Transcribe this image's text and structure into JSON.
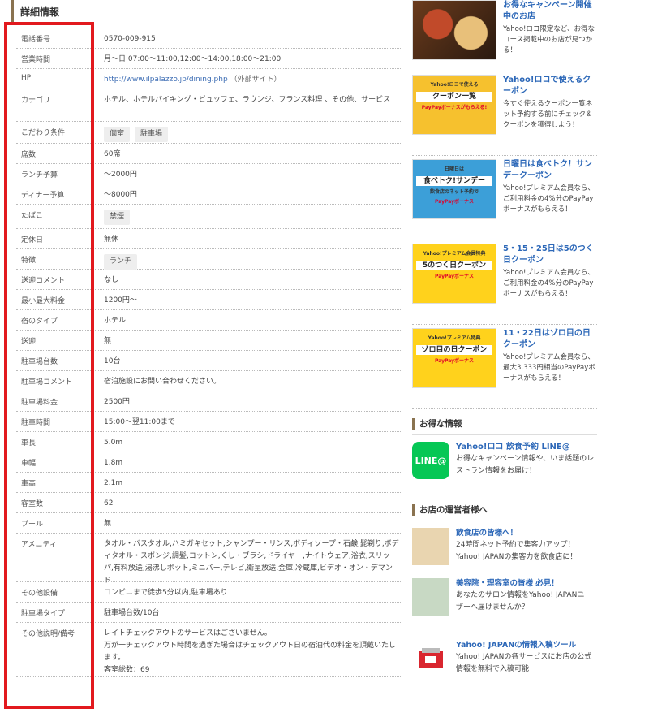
{
  "section_title": "詳細情報",
  "rows": [
    {
      "k": "電話番号",
      "v": "0570-009-915"
    },
    {
      "k": "営業時間",
      "v": "月〜日 07:00〜11:00,12:00〜14:00,18:00〜21:00"
    },
    {
      "k": "HP",
      "link": "http://www.ilpalazzo.jp/dining.php",
      "ext": "（外部サイト）"
    },
    {
      "k": "カテゴリ",
      "v": "ホテル、ホテルバイキング・ビュッフェ、ラウンジ、フランス料理 、その他、サービス"
    },
    {
      "k": "こだわり条件",
      "tags": [
        "個室",
        "駐車場"
      ]
    },
    {
      "k": "席数",
      "v": "60席"
    },
    {
      "k": "ランチ予算",
      "v": "〜2000円"
    },
    {
      "k": "ディナー予算",
      "v": "〜8000円"
    },
    {
      "k": "たばこ",
      "tags": [
        "禁煙"
      ]
    },
    {
      "k": "定休日",
      "v": "無休"
    },
    {
      "k": "特徴",
      "tags": [
        "ランチ"
      ]
    },
    {
      "k": "送迎コメント",
      "v": "なし"
    },
    {
      "k": "最小最大料金",
      "v": "1200円〜"
    },
    {
      "k": "宿のタイプ",
      "v": "ホテル"
    },
    {
      "k": "送迎",
      "v": "無"
    },
    {
      "k": "駐車場台数",
      "v": "10台"
    },
    {
      "k": "駐車場コメント",
      "v": "宿泊施設にお問い合わせください。"
    },
    {
      "k": "駐車場料金",
      "v": "2500円"
    },
    {
      "k": "駐車時間",
      "v": "15:00〜翌11:00まで"
    },
    {
      "k": "車長",
      "v": "5.0m"
    },
    {
      "k": "車幅",
      "v": "1.8m"
    },
    {
      "k": "車高",
      "v": "2.1m"
    },
    {
      "k": "客室数",
      "v": "62"
    },
    {
      "k": "プール",
      "v": "無"
    },
    {
      "k": "アメニティ",
      "v": "タオル・バスタオル,ハミガキセット,シャンプー・リンス,ボディソープ・石鹸,髭剃り,ボディタオル・スポンジ,調髪,コットン,くし・ブラシ,ドライヤー,ナイトウェア,浴衣,スリッパ,有料放送,湯沸しポット,ミニバー,テレビ,衛星放送,金庫,冷蔵庫,ビデオ・オン・デマンド"
    },
    {
      "k": "その他設備",
      "v": "コンビニまで徒歩5分以内,駐車場あり"
    },
    {
      "k": "駐車場タイプ",
      "v": "駐車場台数/10台"
    },
    {
      "k": "その他説明/備考",
      "v": "レイトチェックアウトのサービスはございません。\n万が一チェックアウト時間を過ぎた場合はチェックアウト日の宿泊代の料金を頂戴いたします。\n客室総数：69"
    }
  ],
  "promos": [
    {
      "title": "お得なキャンペーン開催中のお店",
      "desc": "Yahoo!ロコ限定など、お得なコース掲載中のお店が見つかる！"
    },
    {
      "title": "Yahoo!ロコで使えるクーポン",
      "desc": "今すぐ使えるクーポン一覧ネット予約する前にチェック＆クーポンを獲得しよう！",
      "banner": [
        "Yahoo!ロコで使える",
        "クーポン一覧",
        "PayPayボーナスがもらえる!"
      ]
    },
    {
      "title": "日曜日は食べトク！サンデークーポン",
      "desc": "Yahoo!プレミアム会員なら、ご利用料金の4%分のPayPayボーナスがもらえる！",
      "banner": [
        "日曜日は",
        "食べトク!サンデー",
        "飲食店のネット予約で",
        "PayPayボーナス"
      ]
    },
    {
      "title": "5・15・25日は5のつく日クーポン",
      "desc": "Yahoo!プレミアム会員なら、ご利用料金の4%分のPayPayボーナスがもらえる！",
      "banner": [
        "Yahoo!プレミアム会員特典",
        "5のつく日クーポン",
        "PayPayボーナス"
      ]
    },
    {
      "title": "11・22日はゾロ目の日クーポン",
      "desc": "Yahoo!プレミアム会員なら、最大3,333円相当のPayPayボーナスがもらえる！",
      "banner": [
        "Yahoo!プレミアム特典",
        "ゾロ目の日クーポン",
        "PayPayボーナス"
      ]
    }
  ],
  "deals_head": "お得な情報",
  "line_icon": "LINE@",
  "line_title": "Yahoo!ロコ 飲食予約 LINE@",
  "line_desc": "お得なキャンペーン情報や、いま話題のレストラン情報をお届け！",
  "owners_head": "お店の運営者様へ",
  "owners": [
    {
      "title": "飲食店の皆様へ！",
      "desc": "24時間ネット予約で集客力アップ！Yahoo! JAPANの集客力を飲食店に！"
    },
    {
      "title": "美容院・理容室の皆様 必見！",
      "desc": "あなたのサロン情報をYahoo! JAPANユーザーへ届けませんか？"
    },
    {
      "title": "Yahoo! JAPANの情報入稿ツール",
      "desc": "Yahoo! JAPANの各サービスにお店の公式情報を無料で入稿可能"
    }
  ]
}
